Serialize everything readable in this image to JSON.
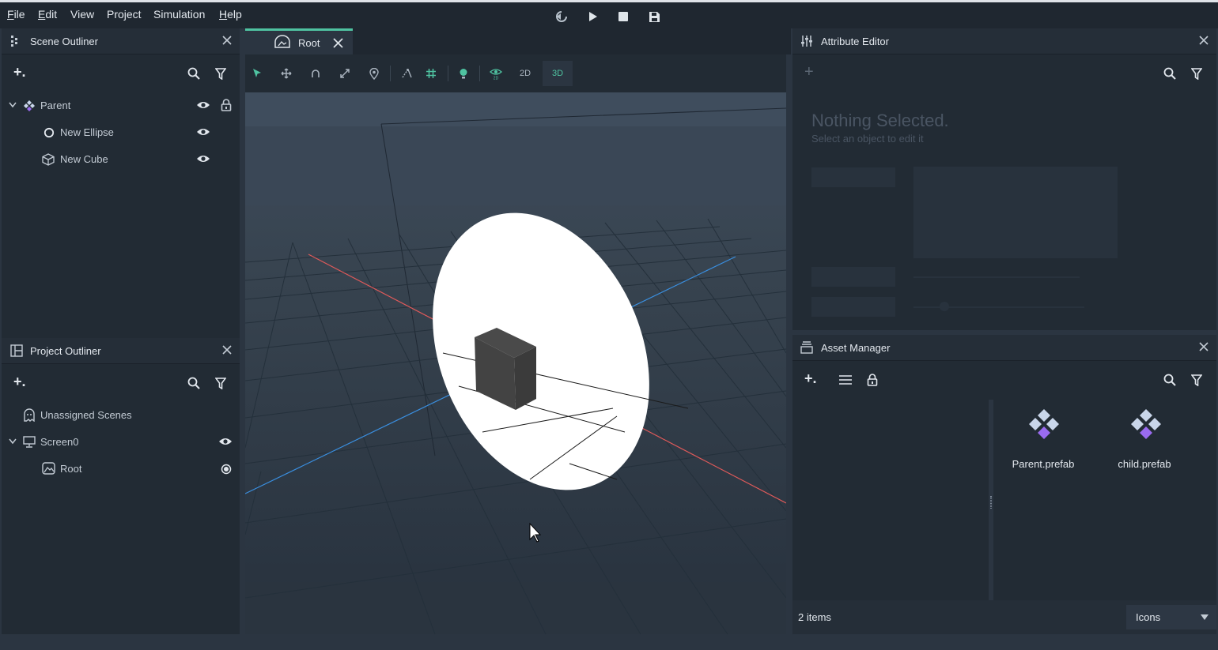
{
  "menu": {
    "file": "File",
    "edit": "Edit",
    "view": "View",
    "project": "Project",
    "simulation": "Simulation",
    "help": "Help"
  },
  "icons": {
    "rewind": "rewind-icon",
    "play": "play-icon",
    "stop": "stop-icon",
    "save": "save-icon"
  },
  "scene_outliner": {
    "title": "Scene Outliner",
    "add_label": "+.",
    "items": [
      {
        "label": "Parent",
        "icon": "prefab-icon",
        "expanded": true
      },
      {
        "label": "New Ellipse",
        "icon": "ellipse-icon"
      },
      {
        "label": "New Cube",
        "icon": "cube-icon"
      }
    ]
  },
  "project_outliner": {
    "title": "Project Outliner",
    "add_label": "+.",
    "items": [
      {
        "label": "Unassigned Scenes",
        "icon": "ghost-icon"
      },
      {
        "label": "Screen0",
        "icon": "monitor-icon",
        "expanded": true
      },
      {
        "label": "Root",
        "icon": "scene-icon"
      }
    ]
  },
  "viewport": {
    "tab_label": "Root",
    "mode_2d": "2D",
    "mode_3d": "3D",
    "active_mode": "3D"
  },
  "attribute_editor": {
    "title": "Attribute Editor",
    "add_label": "+",
    "empty_title": "Nothing Selected.",
    "empty_subtitle": "Select an object to edit it"
  },
  "asset_manager": {
    "title": "Asset Manager",
    "add_label": "+.",
    "assets": [
      {
        "label": "Parent.prefab",
        "icon": "prefab-icon"
      },
      {
        "label": "child.prefab",
        "icon": "prefab-icon"
      }
    ],
    "count_label": "2 items",
    "view_mode": "Icons"
  },
  "colors": {
    "accent": "#4fc3a1",
    "prefab_light": "#c9d6ea",
    "prefab_purple": "#9a6bf0",
    "axis_x": "#e05a5a",
    "axis_z": "#3a8fe0"
  }
}
